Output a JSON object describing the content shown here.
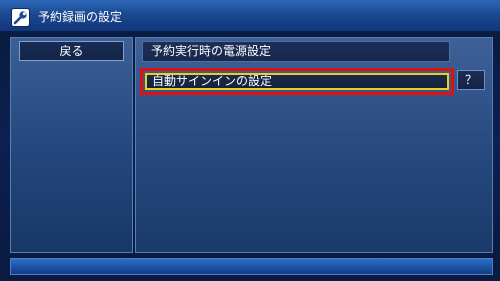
{
  "window": {
    "title": "予約録画の設定",
    "icon": "wrench-icon"
  },
  "left_panel": {
    "back_label": "戻る"
  },
  "right_panel": {
    "section_header": "予約実行時の電源設定",
    "selected_item": "自動サインインの設定",
    "help_label": "？"
  },
  "colors": {
    "highlight_border": "#e01010",
    "focus_outline": "#e8d11a",
    "titlebar": "#1b4a92"
  }
}
